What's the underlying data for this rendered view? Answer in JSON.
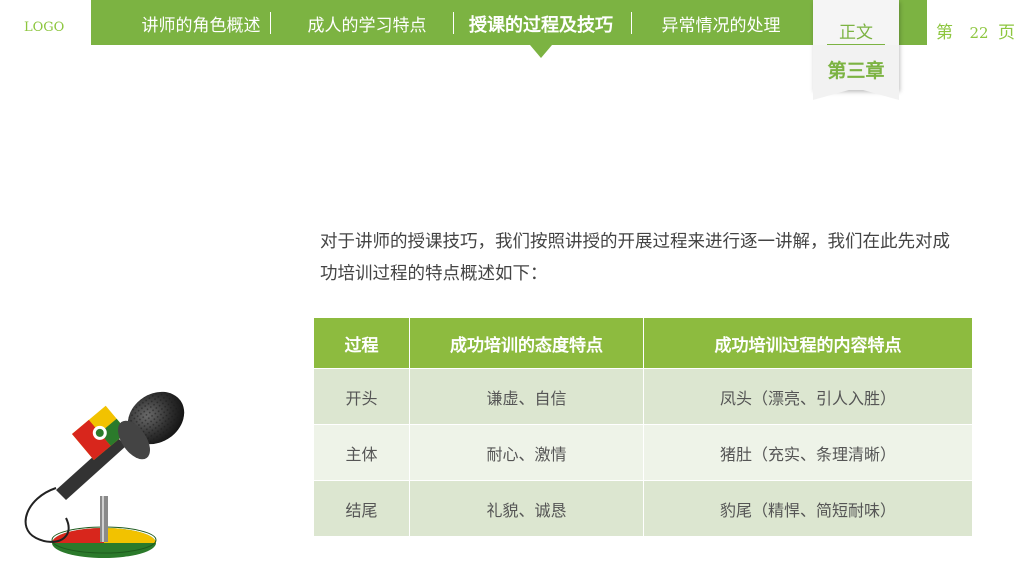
{
  "logo": "LOGO",
  "nav": {
    "items": [
      {
        "label": "讲师的角色概述"
      },
      {
        "label": "成人的学习特点"
      },
      {
        "label": "授课的过程及技巧"
      },
      {
        "label": "异常情况的处理"
      }
    ],
    "active_index": 2
  },
  "tag": {
    "label": "正文",
    "chapter": "第三章"
  },
  "page": {
    "prefix": "第",
    "number": "22",
    "suffix": "页"
  },
  "intro": "对于讲师的授课技巧，我们按照讲授的开展过程来进行逐一讲解，我们在此先对成功培训过程的特点概述如下：",
  "table": {
    "headers": [
      "过程",
      "成功培训的态度特点",
      "成功培训过程的内容特点"
    ],
    "rows": [
      [
        "开头",
        "谦虚、自信",
        "凤头（漂亮、引人入胜）"
      ],
      [
        "主体",
        "耐心、激情",
        "猪肚（充实、条理清晰）"
      ],
      [
        "结尾",
        "礼貌、诚恳",
        "豹尾（精悍、简短耐味）"
      ]
    ]
  },
  "colors": {
    "accent": "#7cb342",
    "header": "#8dbb3f",
    "row_odd": "#dce6d0",
    "row_even": "#eef3e8"
  },
  "illustration": "microphone-icon"
}
